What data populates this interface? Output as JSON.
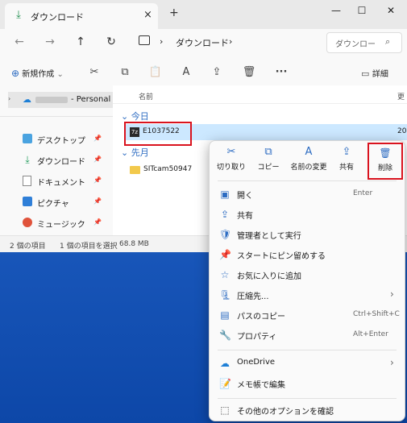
{
  "window": {
    "tab_title": "ダウンロード",
    "tab_close": "×",
    "new_tab": "+",
    "controls": {
      "minimize": "—",
      "maximize": "☐",
      "close": "✕"
    }
  },
  "address": {
    "separator": "›",
    "crumb": "ダウンロード",
    "search_placeholder": "ダウンロー",
    "icons": {
      "back": "←",
      "forward": "→",
      "up": "↑",
      "refresh": "↻",
      "search": "⌕"
    }
  },
  "toolbar": {
    "new_label": "新規作成",
    "new_caret": "⌄",
    "more": "···",
    "detail_label": "詳細",
    "icons": {
      "cut": "✂",
      "copy": "⧉",
      "paste": "📋",
      "rename": "A",
      "share": "⇪",
      "delete": "🗑"
    }
  },
  "sidebar": {
    "onedrive_label": "- Personal",
    "items": [
      {
        "label": "デスクトップ",
        "icon": "desktop-icon",
        "color": "#4aa3e0"
      },
      {
        "label": "ダウンロード",
        "icon": "download-icon",
        "color": "#1f9a5a"
      },
      {
        "label": "ドキュメント",
        "icon": "document-icon",
        "color": "#8a8a8a"
      },
      {
        "label": "ピクチャ",
        "icon": "pictures-icon",
        "color": "#2f7fd8"
      },
      {
        "label": "ミュージック",
        "icon": "music-icon",
        "color": "#e0533b"
      }
    ],
    "pin": "📌"
  },
  "files": {
    "column_name": "名前",
    "column_more": "更",
    "group_today": "今日",
    "group_last_month": "先月",
    "rows": [
      {
        "name": "E1037522",
        "date": "20",
        "icon": "archive-icon"
      },
      {
        "name": "SITcam50947",
        "icon": "folder-icon"
      }
    ]
  },
  "status": {
    "items_count": "2 個の項目",
    "selected": "1 個の項目を選択",
    "size": "68.8 MB"
  },
  "context_menu": {
    "top_actions": [
      {
        "label": "切り取り",
        "icon": "✂"
      },
      {
        "label": "コピー",
        "icon": "⧉"
      },
      {
        "label": "名前の変更",
        "icon": "A"
      },
      {
        "label": "共有",
        "icon": "⇪"
      },
      {
        "label": "削除",
        "icon": "🗑"
      }
    ],
    "items": [
      {
        "label": "開く",
        "shortcut": "Enter",
        "icon": "▣"
      },
      {
        "label": "共有",
        "shortcut": "",
        "icon": "⇪"
      },
      {
        "label": "管理者として実行",
        "shortcut": "",
        "icon": "🛡"
      },
      {
        "label": "スタートにピン留めする",
        "shortcut": "",
        "icon": "📌"
      },
      {
        "label": "お気に入りに追加",
        "shortcut": "",
        "icon": "☆"
      },
      {
        "label": "圧縮先...",
        "shortcut": "›",
        "icon": "🗜"
      },
      {
        "label": "パスのコピー",
        "shortcut": "Ctrl+Shift+C",
        "icon": "▤"
      },
      {
        "label": "プロパティ",
        "shortcut": "Alt+Enter",
        "icon": "🔧"
      }
    ],
    "items2": [
      {
        "label": "OneDrive",
        "shortcut": "›",
        "icon": "☁"
      },
      {
        "label": "メモ帳で編集",
        "shortcut": "",
        "icon": "📝"
      }
    ],
    "more_options": {
      "label": "その他のオプションを確認",
      "icon": "⬚"
    }
  },
  "colors": {
    "highlight": "#d9131e",
    "selection": "#cce8ff",
    "accent": "#2d6cc2"
  }
}
